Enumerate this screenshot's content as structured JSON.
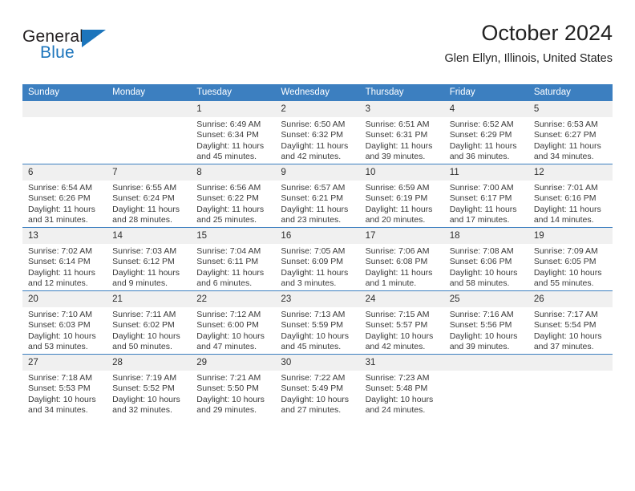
{
  "brand": {
    "name_top": "General",
    "name_bottom": "Blue",
    "color_dark": "#231f20",
    "color_blue": "#1c75bc"
  },
  "header": {
    "title": "October 2024",
    "subtitle": "Glen Ellyn, Illinois, United States",
    "accent_color": "#3c7fc0",
    "daynum_bg": "#f0f0f0"
  },
  "weekday_headers": [
    "Sunday",
    "Monday",
    "Tuesday",
    "Wednesday",
    "Thursday",
    "Friday",
    "Saturday"
  ],
  "weeks": [
    [
      {
        "day": "",
        "sunrise": "",
        "sunset": "",
        "daylight": ""
      },
      {
        "day": "",
        "sunrise": "",
        "sunset": "",
        "daylight": ""
      },
      {
        "day": "1",
        "sunrise": "Sunrise: 6:49 AM",
        "sunset": "Sunset: 6:34 PM",
        "daylight": "Daylight: 11 hours and 45 minutes."
      },
      {
        "day": "2",
        "sunrise": "Sunrise: 6:50 AM",
        "sunset": "Sunset: 6:32 PM",
        "daylight": "Daylight: 11 hours and 42 minutes."
      },
      {
        "day": "3",
        "sunrise": "Sunrise: 6:51 AM",
        "sunset": "Sunset: 6:31 PM",
        "daylight": "Daylight: 11 hours and 39 minutes."
      },
      {
        "day": "4",
        "sunrise": "Sunrise: 6:52 AM",
        "sunset": "Sunset: 6:29 PM",
        "daylight": "Daylight: 11 hours and 36 minutes."
      },
      {
        "day": "5",
        "sunrise": "Sunrise: 6:53 AM",
        "sunset": "Sunset: 6:27 PM",
        "daylight": "Daylight: 11 hours and 34 minutes."
      }
    ],
    [
      {
        "day": "6",
        "sunrise": "Sunrise: 6:54 AM",
        "sunset": "Sunset: 6:26 PM",
        "daylight": "Daylight: 11 hours and 31 minutes."
      },
      {
        "day": "7",
        "sunrise": "Sunrise: 6:55 AM",
        "sunset": "Sunset: 6:24 PM",
        "daylight": "Daylight: 11 hours and 28 minutes."
      },
      {
        "day": "8",
        "sunrise": "Sunrise: 6:56 AM",
        "sunset": "Sunset: 6:22 PM",
        "daylight": "Daylight: 11 hours and 25 minutes."
      },
      {
        "day": "9",
        "sunrise": "Sunrise: 6:57 AM",
        "sunset": "Sunset: 6:21 PM",
        "daylight": "Daylight: 11 hours and 23 minutes."
      },
      {
        "day": "10",
        "sunrise": "Sunrise: 6:59 AM",
        "sunset": "Sunset: 6:19 PM",
        "daylight": "Daylight: 11 hours and 20 minutes."
      },
      {
        "day": "11",
        "sunrise": "Sunrise: 7:00 AM",
        "sunset": "Sunset: 6:17 PM",
        "daylight": "Daylight: 11 hours and 17 minutes."
      },
      {
        "day": "12",
        "sunrise": "Sunrise: 7:01 AM",
        "sunset": "Sunset: 6:16 PM",
        "daylight": "Daylight: 11 hours and 14 minutes."
      }
    ],
    [
      {
        "day": "13",
        "sunrise": "Sunrise: 7:02 AM",
        "sunset": "Sunset: 6:14 PM",
        "daylight": "Daylight: 11 hours and 12 minutes."
      },
      {
        "day": "14",
        "sunrise": "Sunrise: 7:03 AM",
        "sunset": "Sunset: 6:12 PM",
        "daylight": "Daylight: 11 hours and 9 minutes."
      },
      {
        "day": "15",
        "sunrise": "Sunrise: 7:04 AM",
        "sunset": "Sunset: 6:11 PM",
        "daylight": "Daylight: 11 hours and 6 minutes."
      },
      {
        "day": "16",
        "sunrise": "Sunrise: 7:05 AM",
        "sunset": "Sunset: 6:09 PM",
        "daylight": "Daylight: 11 hours and 3 minutes."
      },
      {
        "day": "17",
        "sunrise": "Sunrise: 7:06 AM",
        "sunset": "Sunset: 6:08 PM",
        "daylight": "Daylight: 11 hours and 1 minute."
      },
      {
        "day": "18",
        "sunrise": "Sunrise: 7:08 AM",
        "sunset": "Sunset: 6:06 PM",
        "daylight": "Daylight: 10 hours and 58 minutes."
      },
      {
        "day": "19",
        "sunrise": "Sunrise: 7:09 AM",
        "sunset": "Sunset: 6:05 PM",
        "daylight": "Daylight: 10 hours and 55 minutes."
      }
    ],
    [
      {
        "day": "20",
        "sunrise": "Sunrise: 7:10 AM",
        "sunset": "Sunset: 6:03 PM",
        "daylight": "Daylight: 10 hours and 53 minutes."
      },
      {
        "day": "21",
        "sunrise": "Sunrise: 7:11 AM",
        "sunset": "Sunset: 6:02 PM",
        "daylight": "Daylight: 10 hours and 50 minutes."
      },
      {
        "day": "22",
        "sunrise": "Sunrise: 7:12 AM",
        "sunset": "Sunset: 6:00 PM",
        "daylight": "Daylight: 10 hours and 47 minutes."
      },
      {
        "day": "23",
        "sunrise": "Sunrise: 7:13 AM",
        "sunset": "Sunset: 5:59 PM",
        "daylight": "Daylight: 10 hours and 45 minutes."
      },
      {
        "day": "24",
        "sunrise": "Sunrise: 7:15 AM",
        "sunset": "Sunset: 5:57 PM",
        "daylight": "Daylight: 10 hours and 42 minutes."
      },
      {
        "day": "25",
        "sunrise": "Sunrise: 7:16 AM",
        "sunset": "Sunset: 5:56 PM",
        "daylight": "Daylight: 10 hours and 39 minutes."
      },
      {
        "day": "26",
        "sunrise": "Sunrise: 7:17 AM",
        "sunset": "Sunset: 5:54 PM",
        "daylight": "Daylight: 10 hours and 37 minutes."
      }
    ],
    [
      {
        "day": "27",
        "sunrise": "Sunrise: 7:18 AM",
        "sunset": "Sunset: 5:53 PM",
        "daylight": "Daylight: 10 hours and 34 minutes."
      },
      {
        "day": "28",
        "sunrise": "Sunrise: 7:19 AM",
        "sunset": "Sunset: 5:52 PM",
        "daylight": "Daylight: 10 hours and 32 minutes."
      },
      {
        "day": "29",
        "sunrise": "Sunrise: 7:21 AM",
        "sunset": "Sunset: 5:50 PM",
        "daylight": "Daylight: 10 hours and 29 minutes."
      },
      {
        "day": "30",
        "sunrise": "Sunrise: 7:22 AM",
        "sunset": "Sunset: 5:49 PM",
        "daylight": "Daylight: 10 hours and 27 minutes."
      },
      {
        "day": "31",
        "sunrise": "Sunrise: 7:23 AM",
        "sunset": "Sunset: 5:48 PM",
        "daylight": "Daylight: 10 hours and 24 minutes."
      },
      {
        "day": "",
        "sunrise": "",
        "sunset": "",
        "daylight": ""
      },
      {
        "day": "",
        "sunrise": "",
        "sunset": "",
        "daylight": ""
      }
    ]
  ]
}
